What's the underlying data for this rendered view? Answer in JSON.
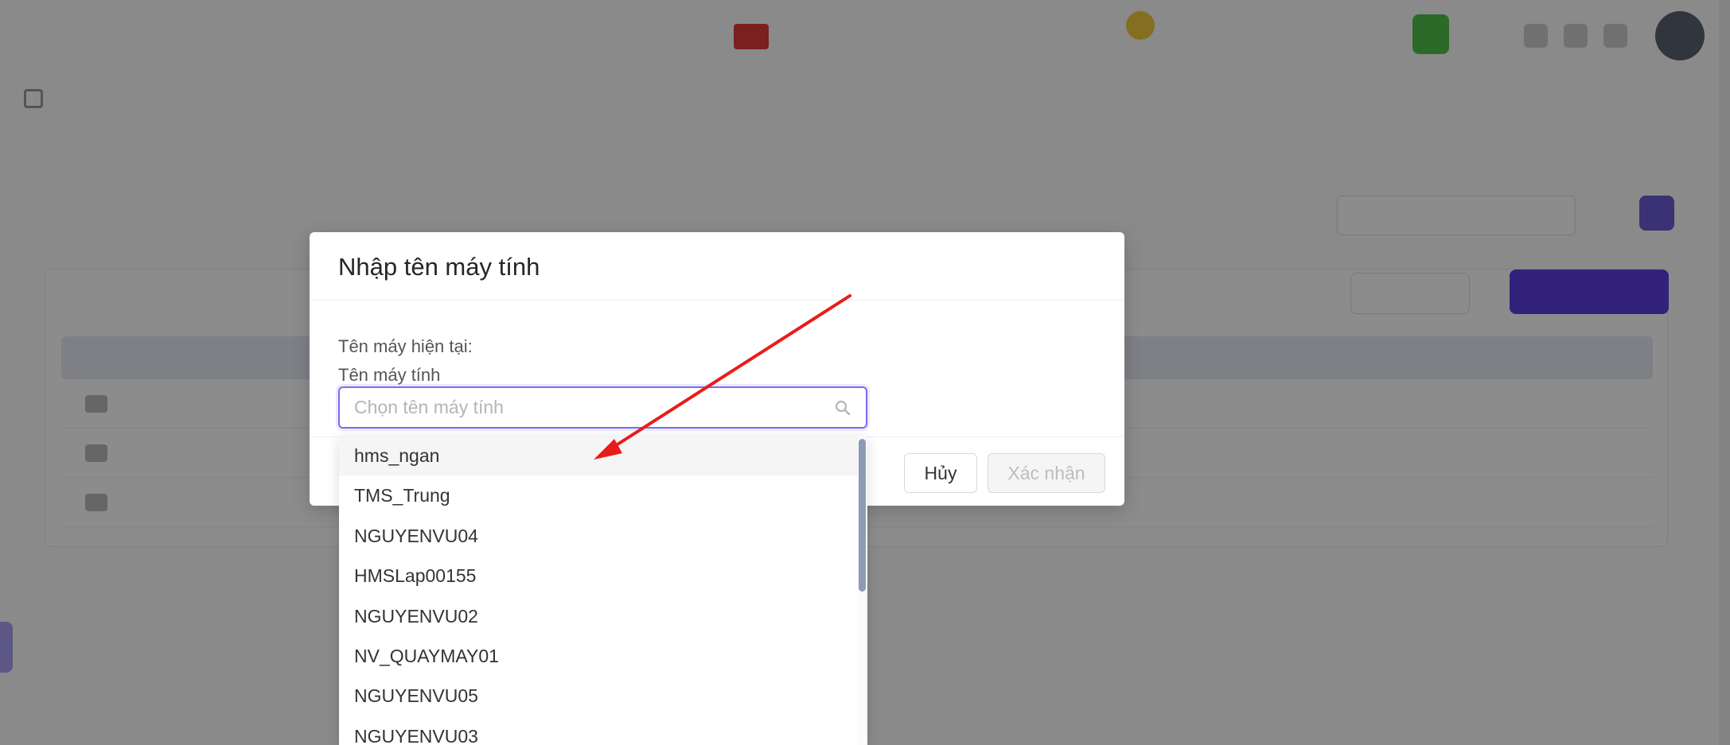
{
  "modal": {
    "title": "Nhập tên máy tính",
    "current_name_label": "Tên máy hiện tại:",
    "computer_name_label": "Tên máy tính",
    "select_placeholder": "Chọn tên máy tính",
    "cancel_label": "Hủy",
    "confirm_label": "Xác nhận"
  },
  "dropdown": {
    "options": [
      "hms_ngan",
      "TMS_Trung",
      "NGUYENVU04",
      "HMSLap00155",
      "NGUYENVU02",
      "NV_QUAYMAY01",
      "NGUYENVU05",
      "NGUYENVU03"
    ],
    "highlighted_index": 0,
    "scroll_thumb_color": "#8e9ab5"
  },
  "colors": {
    "overlay": "rgba(0,0,0,0.45)",
    "focus_border": "#7b6cf0",
    "annotation_arrow": "#e81c1c"
  },
  "icons": {
    "select_suffix": "search-icon"
  }
}
